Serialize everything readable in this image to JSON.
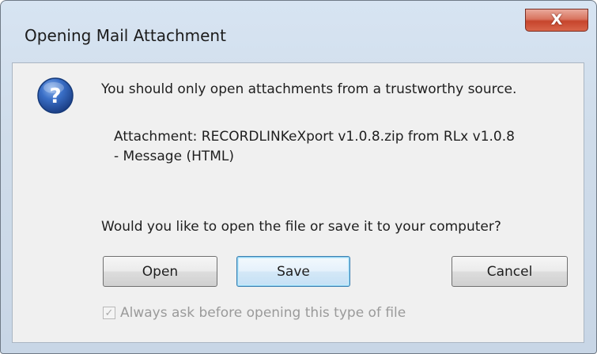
{
  "window": {
    "title": "Opening Mail Attachment",
    "close_glyph": "X"
  },
  "dialog": {
    "icon": "question-icon",
    "icon_glyph": "?",
    "message": "You should only open attachments from a trustworthy source.",
    "attachment_line1": "Attachment: RECORDLINKeXport v1.0.8.zip from RLx v1.0.8",
    "attachment_line2": "- Message (HTML)",
    "question": "Would you like to open the file or save it to your computer?"
  },
  "buttons": {
    "open_label": "Open",
    "save_label": "Save",
    "cancel_label": "Cancel"
  },
  "checkbox": {
    "label": "Always ask before opening this type of file",
    "checked": true,
    "enabled": false,
    "check_glyph": "✓"
  },
  "colors": {
    "accent_focus": "#3c7fb1",
    "close_red": "#c6452c",
    "icon_blue": "#2f5fb0"
  }
}
